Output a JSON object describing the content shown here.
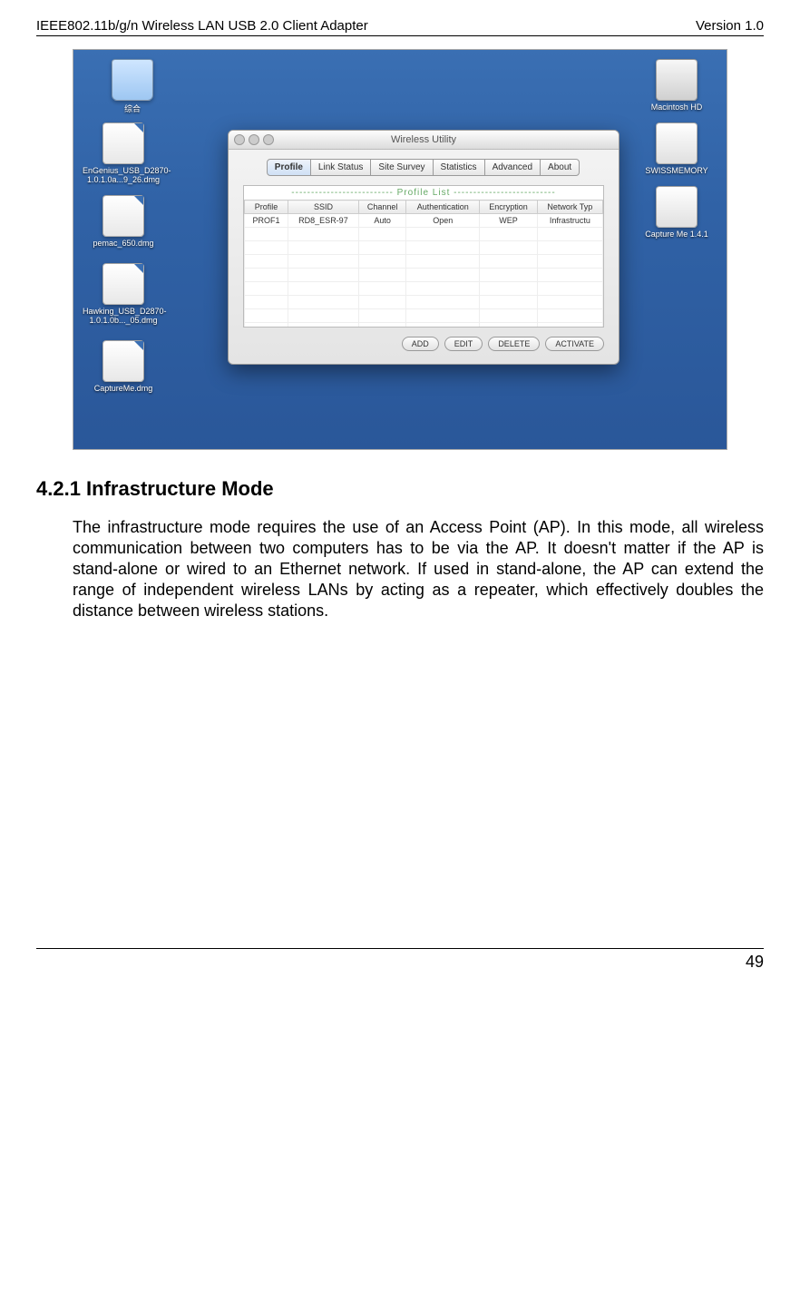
{
  "header": {
    "left": "IEEE802.11b/g/n Wireless LAN USB 2.0 Client Adapter",
    "right": "Version 1.0"
  },
  "desktop_icons": {
    "folder1": "综合",
    "file1": "EnGenius_USB_D2870-1.0.1.0a...9_26.dmg",
    "file2": "pemac_650.dmg",
    "file3": "Hawking_USB_D2870-1.0.1.0b..._05.dmg",
    "file4": "CaptureMe.dmg",
    "drive1": "Macintosh HD",
    "drive2": "SWISSMEMORY",
    "drive3": "Capture Me 1.4.1"
  },
  "window": {
    "title": "Wireless Utility",
    "tabs": [
      "Profile",
      "Link Status",
      "Site Survey",
      "Statistics",
      "Advanced",
      "About"
    ],
    "list_title": "--------------------------  Profile List  --------------------------",
    "columns": [
      "Profile",
      "SSID",
      "Channel",
      "Authentication",
      "Encryption",
      "Network Typ"
    ],
    "row1": {
      "profile": "PROF1",
      "ssid": "RD8_ESR-97",
      "channel": "Auto",
      "auth": "Open",
      "enc": "WEP",
      "net": "Infrastructu"
    },
    "buttons": [
      "ADD",
      "EDIT",
      "DELETE",
      "ACTIVATE"
    ]
  },
  "section": {
    "heading": "4.2.1 Infrastructure Mode",
    "body": "The infrastructure mode requires the use of an Access Point (AP). In this mode, all wireless communication between two computers has to be via the AP. It doesn't matter if the AP is stand-alone or wired to an Ethernet network. If used in stand-alone, the AP can extend the range of independent wireless LANs by acting as a repeater, which effectively doubles the distance between wireless stations."
  },
  "footer": {
    "page": "49"
  }
}
